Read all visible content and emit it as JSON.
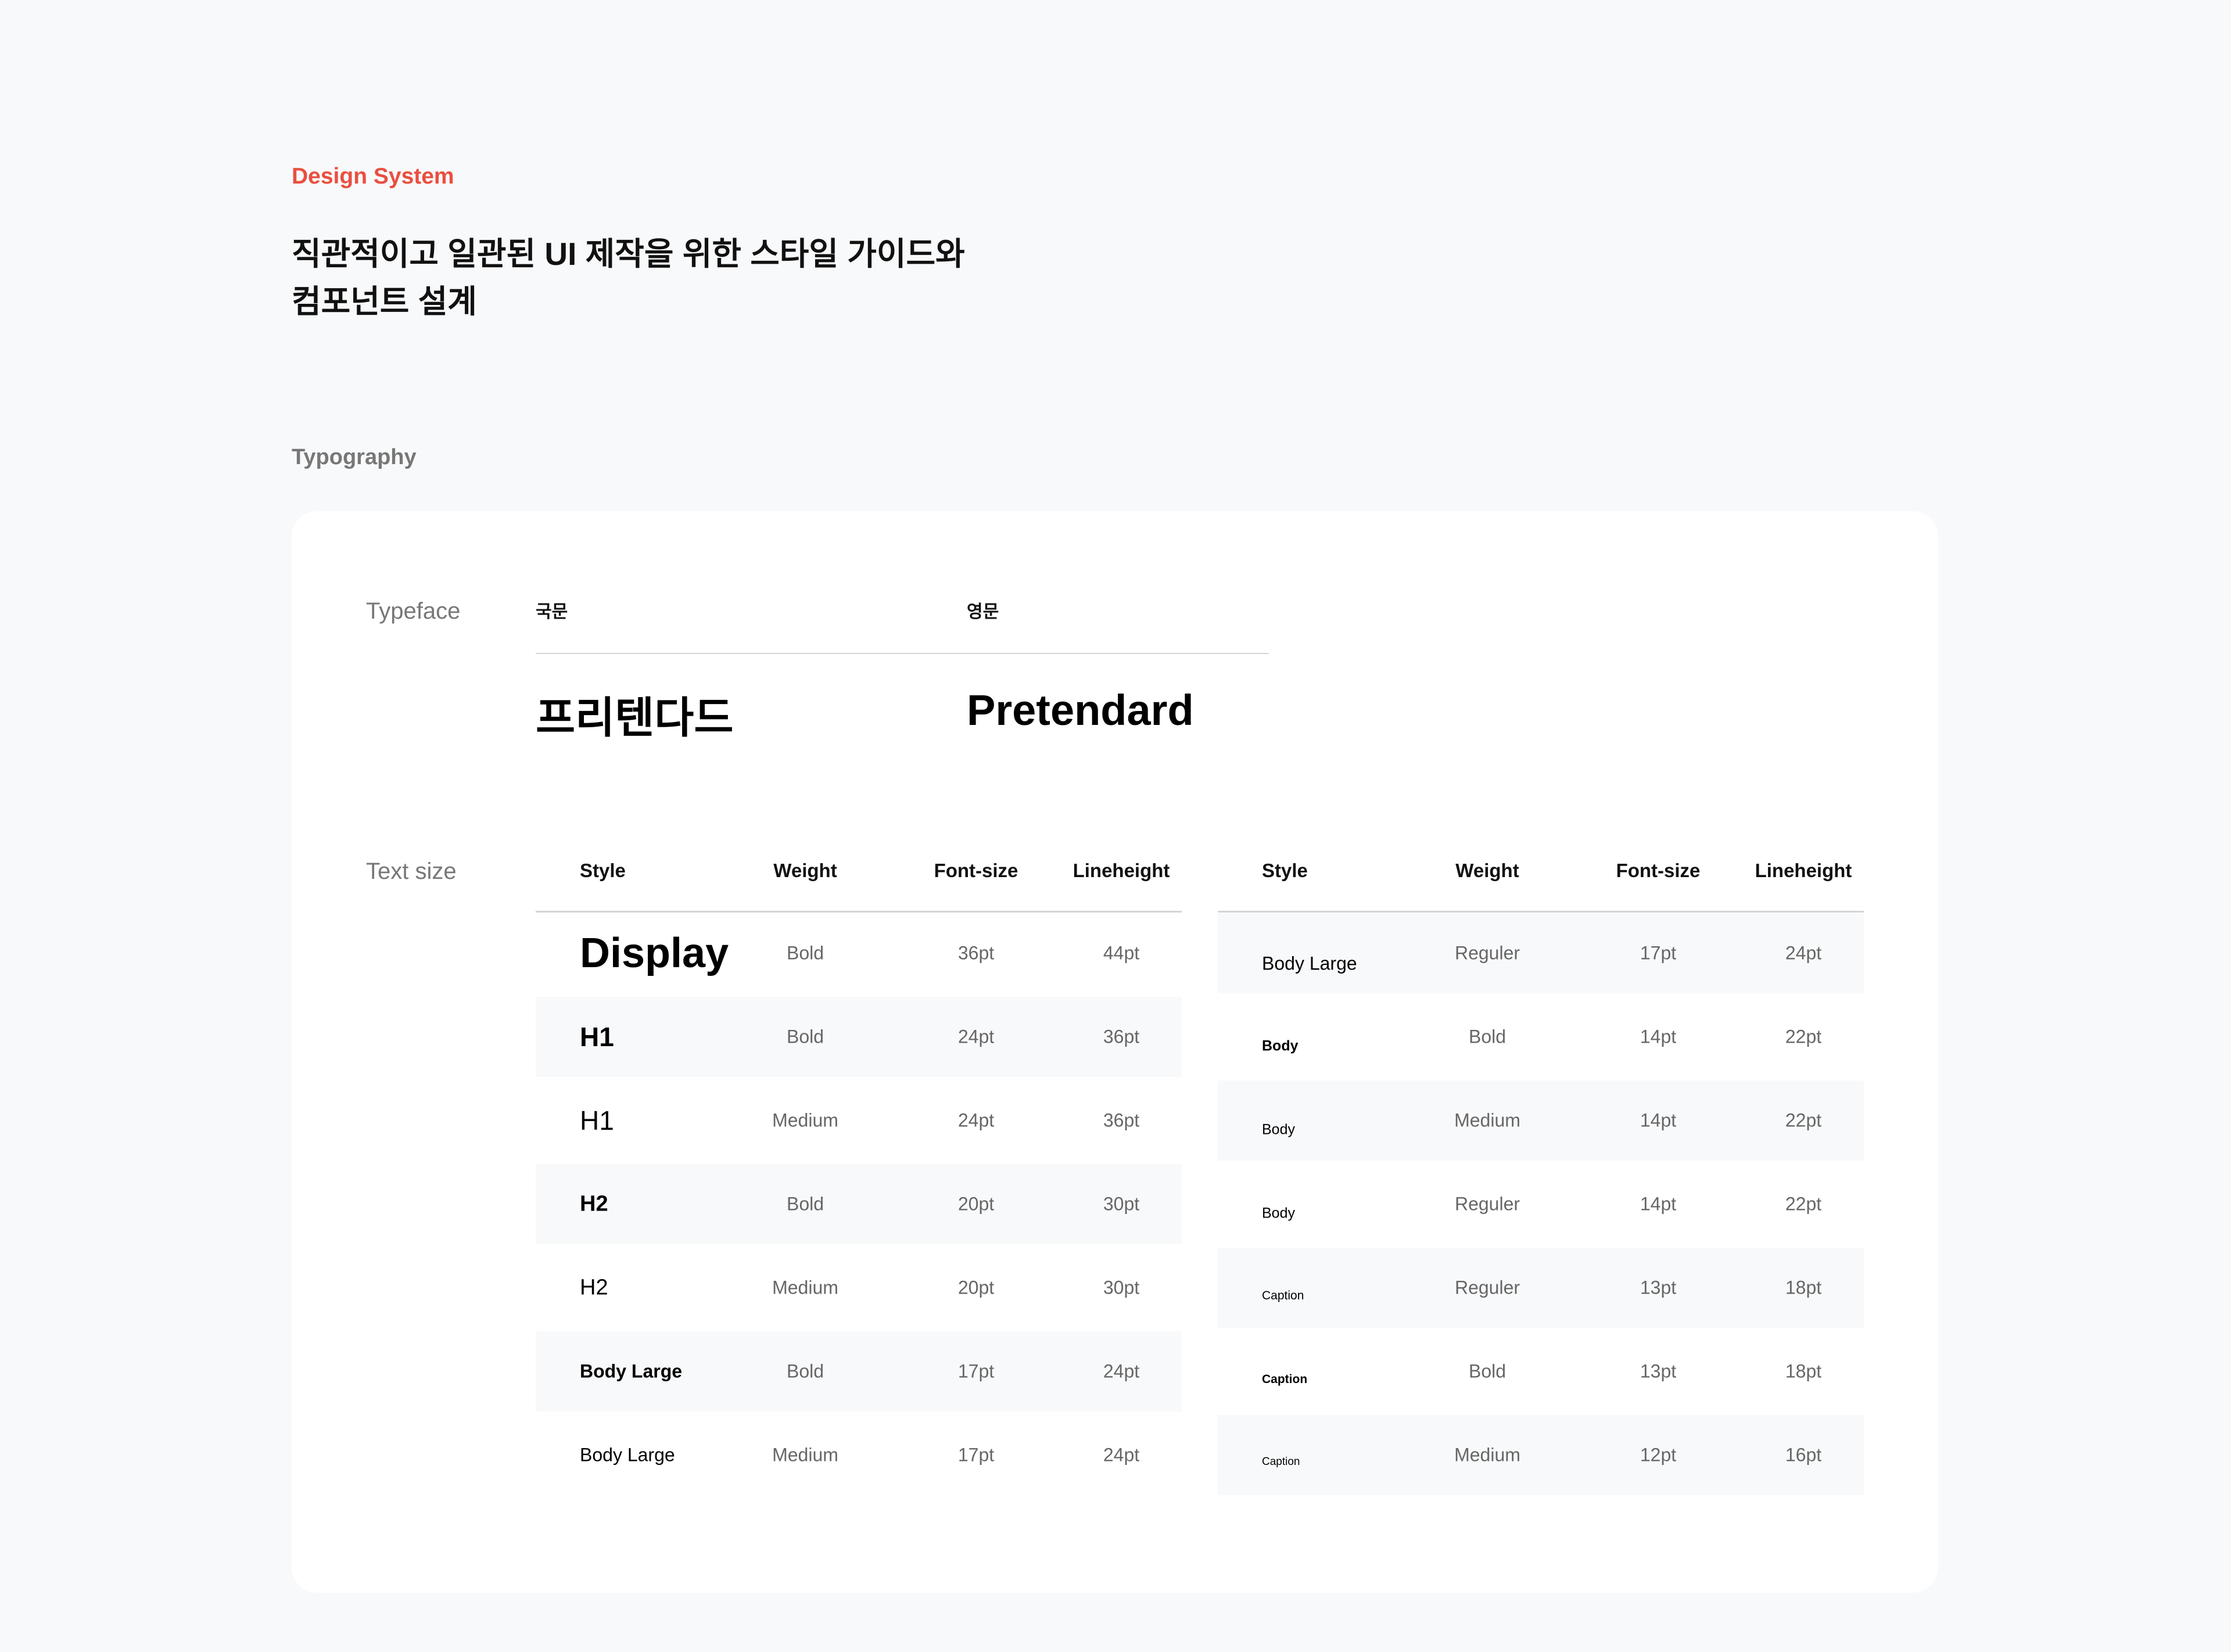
{
  "header": {
    "eyebrow": "Design System",
    "title_line1": "직관적이고 일관된 UI 제작을 위한 스타일 가이드와",
    "title_line2": "컴포넌트 설계"
  },
  "section": {
    "title": "Typography"
  },
  "typeface": {
    "label": "Typeface",
    "korean_header": "국문",
    "english_header": "영문",
    "korean_sample": "프리텐다드",
    "english_sample": "Pretendard"
  },
  "text_size": {
    "label": "Text size",
    "columns": [
      "Style",
      "Weight",
      "Font-size",
      "Lineheight"
    ],
    "left_rows": [
      {
        "style": "Display",
        "weight": "Bold",
        "size": "36pt",
        "line": "44pt"
      },
      {
        "style": "H1",
        "weight": "Bold",
        "size": "24pt",
        "line": "36pt"
      },
      {
        "style": "H1",
        "weight": "Medium",
        "size": "24pt",
        "line": "36pt"
      },
      {
        "style": "H2",
        "weight": "Bold",
        "size": "20pt",
        "line": "30pt"
      },
      {
        "style": "H2",
        "weight": "Medium",
        "size": "20pt",
        "line": "30pt"
      },
      {
        "style": "Body Large",
        "weight": "Bold",
        "size": "17pt",
        "line": "24pt"
      },
      {
        "style": "Body Large",
        "weight": "Medium",
        "size": "17pt",
        "line": "24pt"
      }
    ],
    "right_rows": [
      {
        "style": "Body Large",
        "weight": "Reguler",
        "size": "17pt",
        "line": "24pt"
      },
      {
        "style": "Body",
        "weight": "Bold",
        "size": "14pt",
        "line": "22pt"
      },
      {
        "style": "Body",
        "weight": "Medium",
        "size": "14pt",
        "line": "22pt"
      },
      {
        "style": "Body",
        "weight": "Reguler",
        "size": "14pt",
        "line": "22pt"
      },
      {
        "style": "Caption",
        "weight": "Reguler",
        "size": "13pt",
        "line": "18pt"
      },
      {
        "style": "Caption",
        "weight": "Bold",
        "size": "13pt",
        "line": "18pt"
      },
      {
        "style": "Caption",
        "weight": "Medium",
        "size": "12pt",
        "line": "16pt"
      }
    ]
  }
}
